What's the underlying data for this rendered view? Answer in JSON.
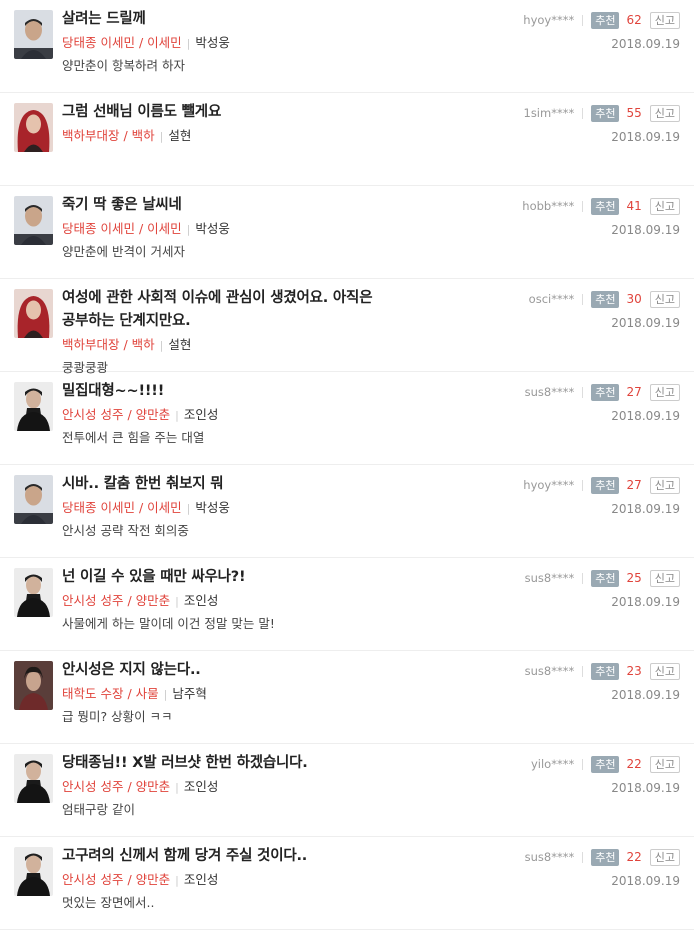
{
  "recommend_label": "추천",
  "report_label": "신고",
  "comments": [
    {
      "avatar": "avatar-park",
      "title": "살려는 드릴께",
      "role": "당태종 이세민 / 이세민",
      "actor": "박성웅",
      "text": "양만춘이 항복하려 하자",
      "user": "hyoy****",
      "count": "62",
      "date": "2018.09.19"
    },
    {
      "avatar": "avatar-seol",
      "title": "그럼 선배님 이름도 뺄게요",
      "role": "백하부대장 / 백하",
      "actor": "설현",
      "text": "",
      "user": "1sim****",
      "count": "55",
      "date": "2018.09.19"
    },
    {
      "avatar": "avatar-park",
      "title": "죽기 딱 좋은 날씨네",
      "role": "당태종 이세민 / 이세민",
      "actor": "박성웅",
      "text": "양만춘에 반격이 거세자",
      "user": "hobb****",
      "count": "41",
      "date": "2018.09.19"
    },
    {
      "avatar": "avatar-seol",
      "title": "여성에 관한 사회적 이슈에 관심이 생겼어요. 아직은\n공부하는 단계지만요.",
      "role": "백하부대장 / 백하",
      "actor": "설현",
      "text": "쿵쾅쿵쾅",
      "user": "osci****",
      "count": "30",
      "date": "2018.09.19"
    },
    {
      "avatar": "avatar-jo",
      "title": "밀집대형~~!!!!",
      "role": "안시성 성주 / 양만춘",
      "actor": "조인성",
      "text": "전투에서 큰 힘을 주는 대열",
      "user": "sus8****",
      "count": "27",
      "date": "2018.09.19"
    },
    {
      "avatar": "avatar-park",
      "title": "시바.. 칼춤 한번 춰보지 뭐",
      "role": "당태종 이세민 / 이세민",
      "actor": "박성웅",
      "text": "안시성 공략 작전 회의중",
      "user": "hyoy****",
      "count": "27",
      "date": "2018.09.19"
    },
    {
      "avatar": "avatar-jo",
      "title": "넌 이길 수 있을 때만 싸우나?!",
      "role": "안시성 성주 / 양만춘",
      "actor": "조인성",
      "text": "사물에게 하는 말이데 이건 정말 맞는 말!",
      "user": "sus8****",
      "count": "25",
      "date": "2018.09.19"
    },
    {
      "avatar": "avatar-nam",
      "title": "안시성은 지지 않는다..",
      "role": "태학도 수장 / 사물",
      "actor": "남주혁",
      "text": "급 뭥미? 상황이 ㅋㅋ",
      "user": "sus8****",
      "count": "23",
      "date": "2018.09.19"
    },
    {
      "avatar": "avatar-jo",
      "title": "당태종님!! X발 러브샷 한번 하겠습니다.",
      "role": "안시성 성주 / 양만춘",
      "actor": "조인성",
      "text": "엄태구랑 같이",
      "user": "yilo****",
      "count": "22",
      "date": "2018.09.19"
    },
    {
      "avatar": "avatar-jo",
      "title": "고구려의 신께서 함께 당겨 주실 것이다..",
      "role": "안시성 성주 / 양만춘",
      "actor": "조인성",
      "text": "멋있는 장면에서..",
      "user": "sus8****",
      "count": "22",
      "date": "2018.09.19"
    }
  ]
}
